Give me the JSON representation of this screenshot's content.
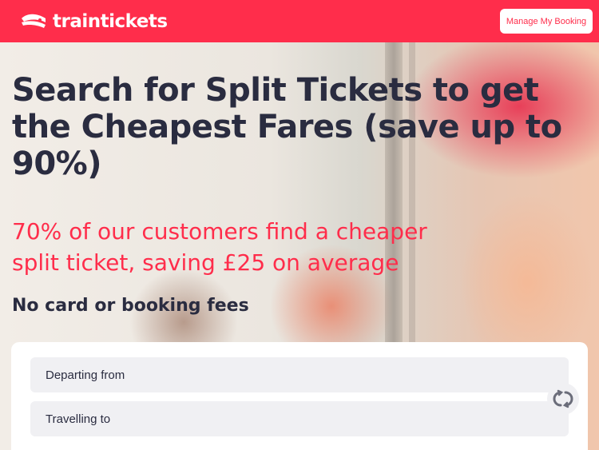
{
  "header": {
    "brand": "traintickets",
    "manage_booking_label": "Manage My Booking",
    "brand_color": "#ff2d4b"
  },
  "hero": {
    "headline_lines": [
      "Search for Split Tickets to get",
      "the Cheapest Fares (save up to",
      "90%)"
    ],
    "subline_lines": [
      "70% of our customers find a cheaper",
      "split ticket, saving £25 on average"
    ],
    "fees_text": "No card or booking fees"
  },
  "search": {
    "from_placeholder": "Departing from",
    "to_placeholder": "Travelling to",
    "swap_icon": "swap-arrows-icon"
  }
}
